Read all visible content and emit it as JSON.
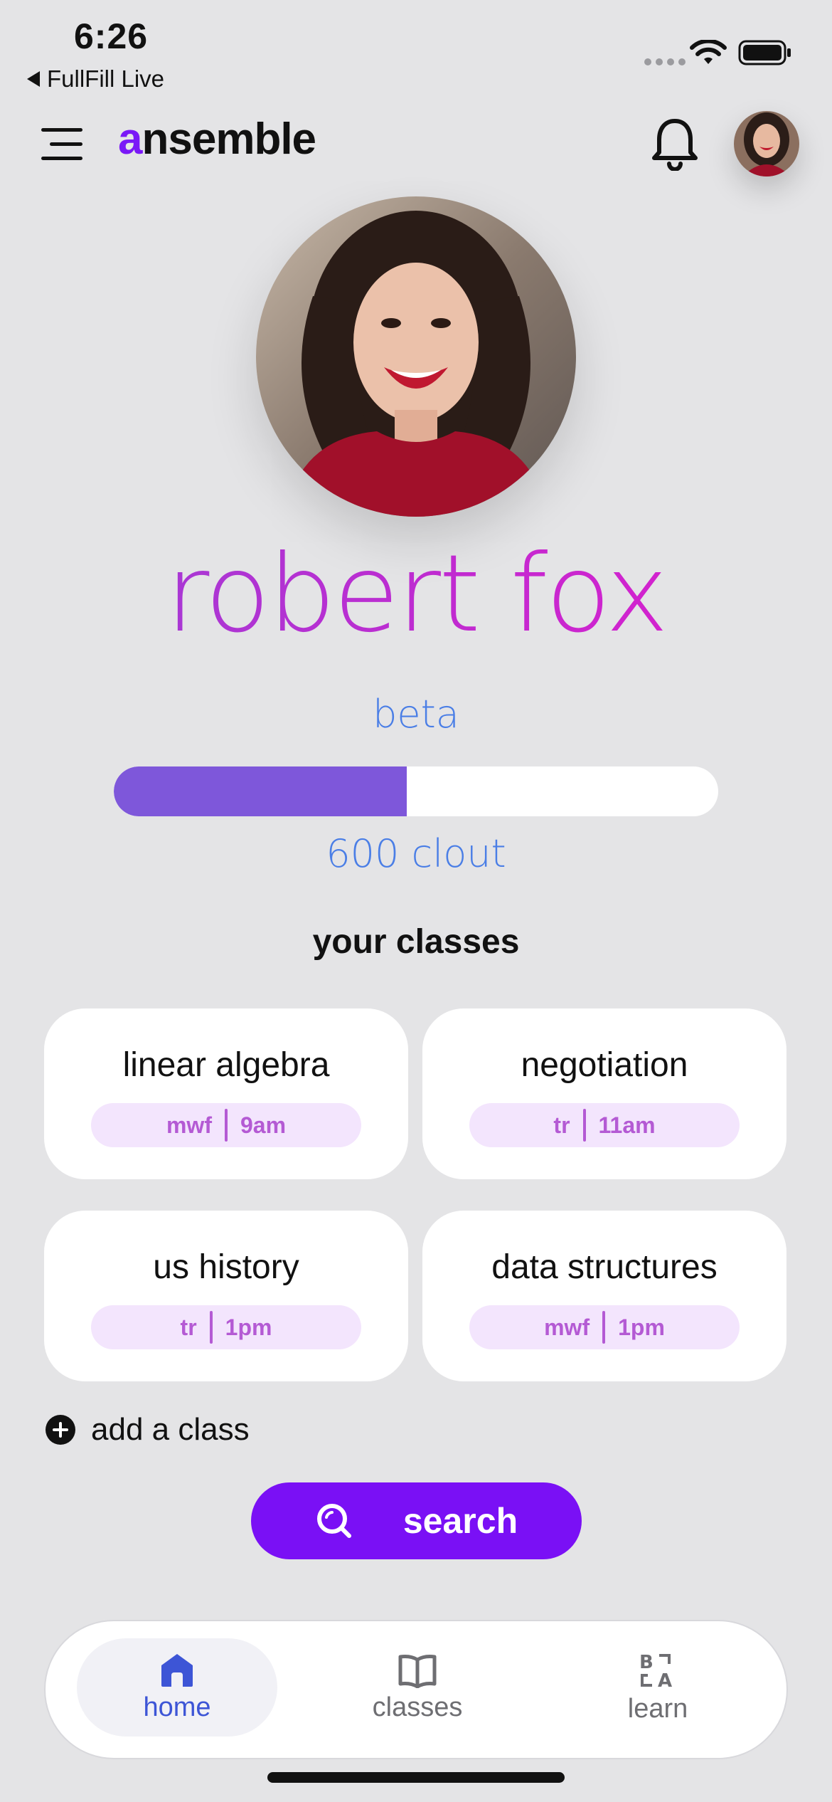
{
  "status_bar": {
    "time": "6:26",
    "back_app": "FullFill Live"
  },
  "header": {
    "brand_prefix": "a",
    "brand_rest": "nsemble",
    "icons": [
      "menu-icon",
      "bell-icon",
      "avatar"
    ]
  },
  "profile": {
    "name": "robert fox",
    "level": "beta",
    "progress": 0.485,
    "clout": "600 clout"
  },
  "classes": {
    "title": "your classes",
    "items": [
      {
        "name": "linear algebra",
        "days": "mwf",
        "time": "9am"
      },
      {
        "name": "negotiation",
        "days": "tr",
        "time": "11am"
      },
      {
        "name": "us history",
        "days": "tr",
        "time": "1pm"
      },
      {
        "name": "data structures",
        "days": "mwf",
        "time": "1pm"
      }
    ],
    "add_label": "add a class"
  },
  "search": {
    "label": "search"
  },
  "nav": {
    "items": [
      {
        "label": "home",
        "icon": "home-icon",
        "active": true
      },
      {
        "label": "classes",
        "icon": "book-icon",
        "active": false
      },
      {
        "label": "learn",
        "icon": "translate-icon",
        "active": false
      }
    ]
  },
  "colors": {
    "accent": "#7a10f5",
    "progress_fill": "#7e57da",
    "pill_bg": "#f3e5fd",
    "pill_text": "#b45ad4",
    "link_blue": "#4a7ee6",
    "nav_active": "#3d55d6"
  }
}
